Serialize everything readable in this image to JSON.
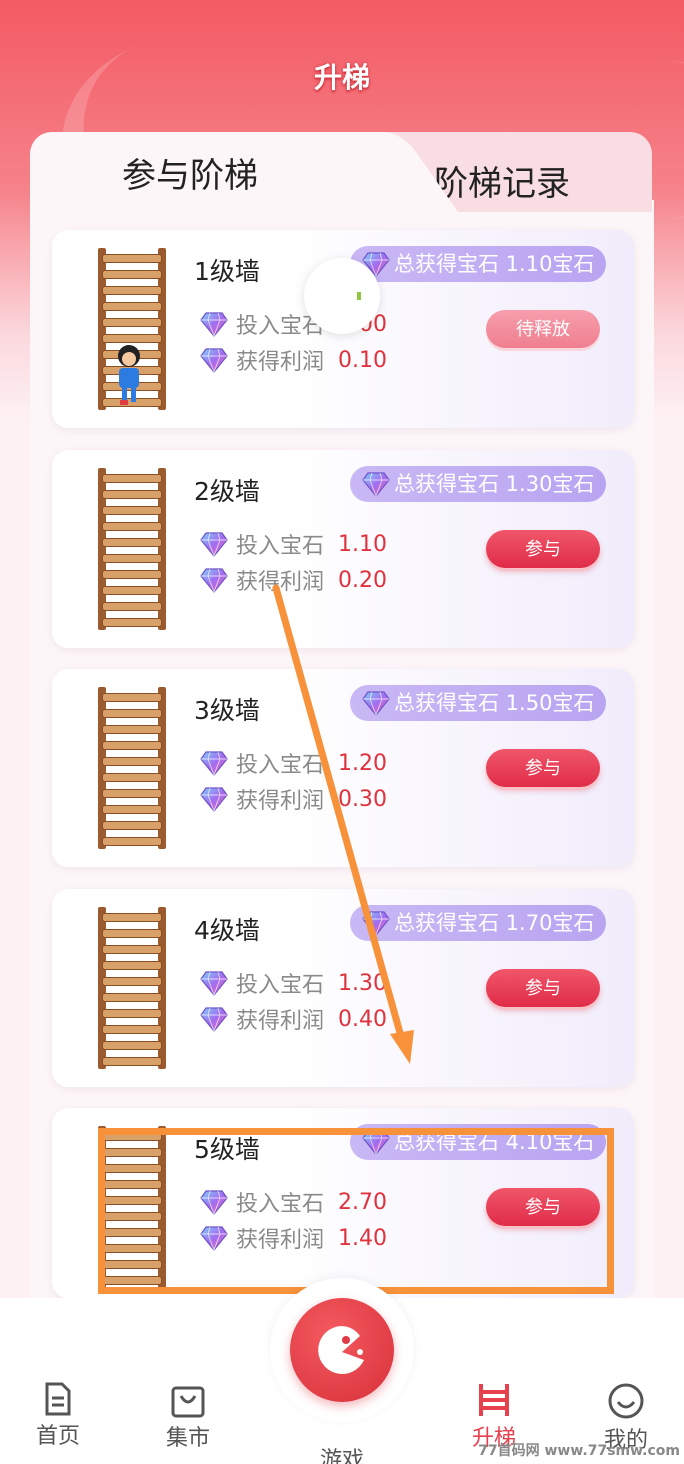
{
  "page": {
    "title": "升梯"
  },
  "tabs": [
    {
      "label": "参与阶梯",
      "active": true
    },
    {
      "label": "阶梯记录",
      "active": false
    }
  ],
  "cards": [
    {
      "level": "1级墙",
      "total": "总获得宝石 1.10宝石",
      "invest_label": "投入宝石",
      "invest_value": "1.00",
      "profit_label": "获得利润",
      "profit_value": "0.10",
      "button": "待释放",
      "button_state": "pending"
    },
    {
      "level": "2级墙",
      "total": "总获得宝石 1.30宝石",
      "invest_label": "投入宝石",
      "invest_value": "1.10",
      "profit_label": "获得利润",
      "profit_value": "0.20",
      "button": "参与",
      "button_state": "join"
    },
    {
      "level": "3级墙",
      "total": "总获得宝石 1.50宝石",
      "invest_label": "投入宝石",
      "invest_value": "1.20",
      "profit_label": "获得利润",
      "profit_value": "0.30",
      "button": "参与",
      "button_state": "join"
    },
    {
      "level": "4级墙",
      "total": "总获得宝石 1.70宝石",
      "invest_label": "投入宝石",
      "invest_value": "1.30",
      "profit_label": "获得利润",
      "profit_value": "0.40",
      "button": "参与",
      "button_state": "join"
    },
    {
      "level": "5级墙",
      "total": "总获得宝石 4.10宝石",
      "invest_label": "投入宝石",
      "invest_value": "2.70",
      "profit_label": "获得利润",
      "profit_value": "1.40",
      "button": "参与",
      "button_state": "join"
    }
  ],
  "nav": [
    {
      "label": "首页",
      "icon": "document-icon",
      "active": false
    },
    {
      "label": "集市",
      "icon": "shopping-bag-icon",
      "active": false
    },
    {
      "label": "游戏",
      "icon": "game-pacman-icon",
      "active": false
    },
    {
      "label": "升梯",
      "icon": "ladder-icon",
      "active": true
    },
    {
      "label": "我的",
      "icon": "smiley-icon",
      "active": false
    }
  ],
  "watermark": "77首码网 www.77smw.com",
  "colors": {
    "accent": "#e7414e",
    "pill": "#b9a4f1",
    "highlight": "#f7913a"
  }
}
